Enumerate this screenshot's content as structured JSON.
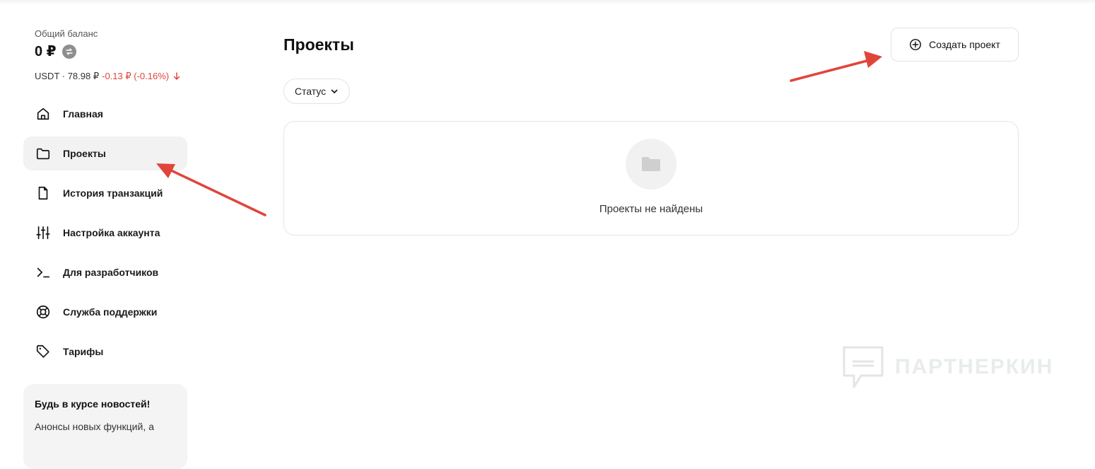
{
  "balance": {
    "label": "Общий баланс",
    "value": "0 ₽",
    "rate_prefix": "USDT · 78.98 ₽",
    "rate_change": "-0.13 ₽ (-0.16%)"
  },
  "nav": {
    "items": [
      {
        "label": "Главная",
        "icon": "home-icon"
      },
      {
        "label": "Проекты",
        "icon": "folder-icon",
        "active": true
      },
      {
        "label": "История транзакций",
        "icon": "document-icon"
      },
      {
        "label": "Настройка аккаунта",
        "icon": "sliders-icon"
      },
      {
        "label": "Для разработчиков",
        "icon": "terminal-icon"
      },
      {
        "label": "Служба поддержки",
        "icon": "lifebuoy-icon"
      },
      {
        "label": "Тарифы",
        "icon": "tag-icon"
      }
    ]
  },
  "news": {
    "title": "Будь в курсе новостей!",
    "text": "Анонсы новых функций, а"
  },
  "main": {
    "title": "Проекты",
    "create_button": "Создать проект",
    "status_filter": "Статус",
    "empty_text": "Проекты не найдены"
  },
  "watermark": {
    "text": "ПАРТНЕРКИН"
  },
  "colors": {
    "accent_red": "#e0453a",
    "active_bg": "#f2f2f2",
    "border": "#e3e3e3"
  }
}
